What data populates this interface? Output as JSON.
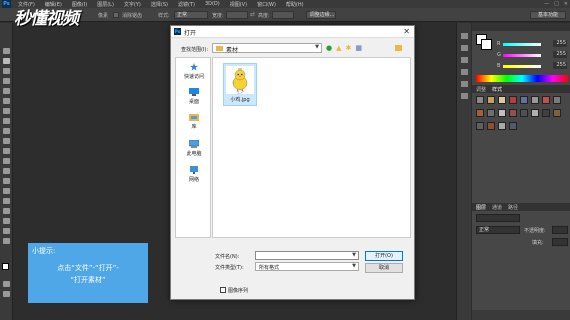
{
  "app": {
    "logo": "Ps"
  },
  "menu": [
    "文件(F)",
    "编辑(E)",
    "图像(I)",
    "图层(L)",
    "文字(Y)",
    "选择(S)",
    "滤镜(T)",
    "3D(D)",
    "视图(V)",
    "窗口(W)",
    "帮助(H)"
  ],
  "watermark": "秒懂视频",
  "options_bar": {
    "feather_value": "像素",
    "antialias_label": "消除锯齿",
    "style_label": "样式:",
    "style_value": "正常",
    "width_label": "宽度:",
    "height_label": "高度:",
    "refine_edge": "调整边缘...",
    "workspace": "基本功能"
  },
  "color_panel": {
    "r_label": "R",
    "r_value": "255",
    "g_label": "G",
    "g_value": "255",
    "b_label": "B",
    "b_value": "255"
  },
  "panel_tabs": {
    "adjust_tab": "调整",
    "styles_tab": "样式",
    "layers_tab": "图层",
    "channels_tab": "通道",
    "paths_tab": "路径",
    "layer_kind": "正常",
    "opacity_label": "不透明度:",
    "fill_label": "填充:"
  },
  "tip": {
    "title": "小提示:",
    "line1": "点击“文件”-“打开”-",
    "line2": "“打开素材”"
  },
  "dialog": {
    "title": "打开",
    "lookin_label": "查找范围(I):",
    "lookin_value": "素材",
    "sidebar": [
      {
        "label": "快速访问",
        "icon": "star-icon",
        "color": "#2f7fd8"
      },
      {
        "label": "桌面",
        "icon": "desktop-icon",
        "color": "#1e88e5"
      },
      {
        "label": "库",
        "icon": "library-icon",
        "color": "#e8b84a"
      },
      {
        "label": "此电脑",
        "icon": "computer-icon",
        "color": "#4a9ee8"
      },
      {
        "label": "网络",
        "icon": "network-icon",
        "color": "#3d8fd6"
      }
    ],
    "file": {
      "name": "小鸡.jpg"
    },
    "filename_label": "文件名(N):",
    "filename_value": "",
    "filetype_label": "文件类型(T):",
    "filetype_value": "所有格式",
    "open_button": "打开(O)",
    "cancel_button": "取消",
    "sequence_label": "图像序列"
  }
}
